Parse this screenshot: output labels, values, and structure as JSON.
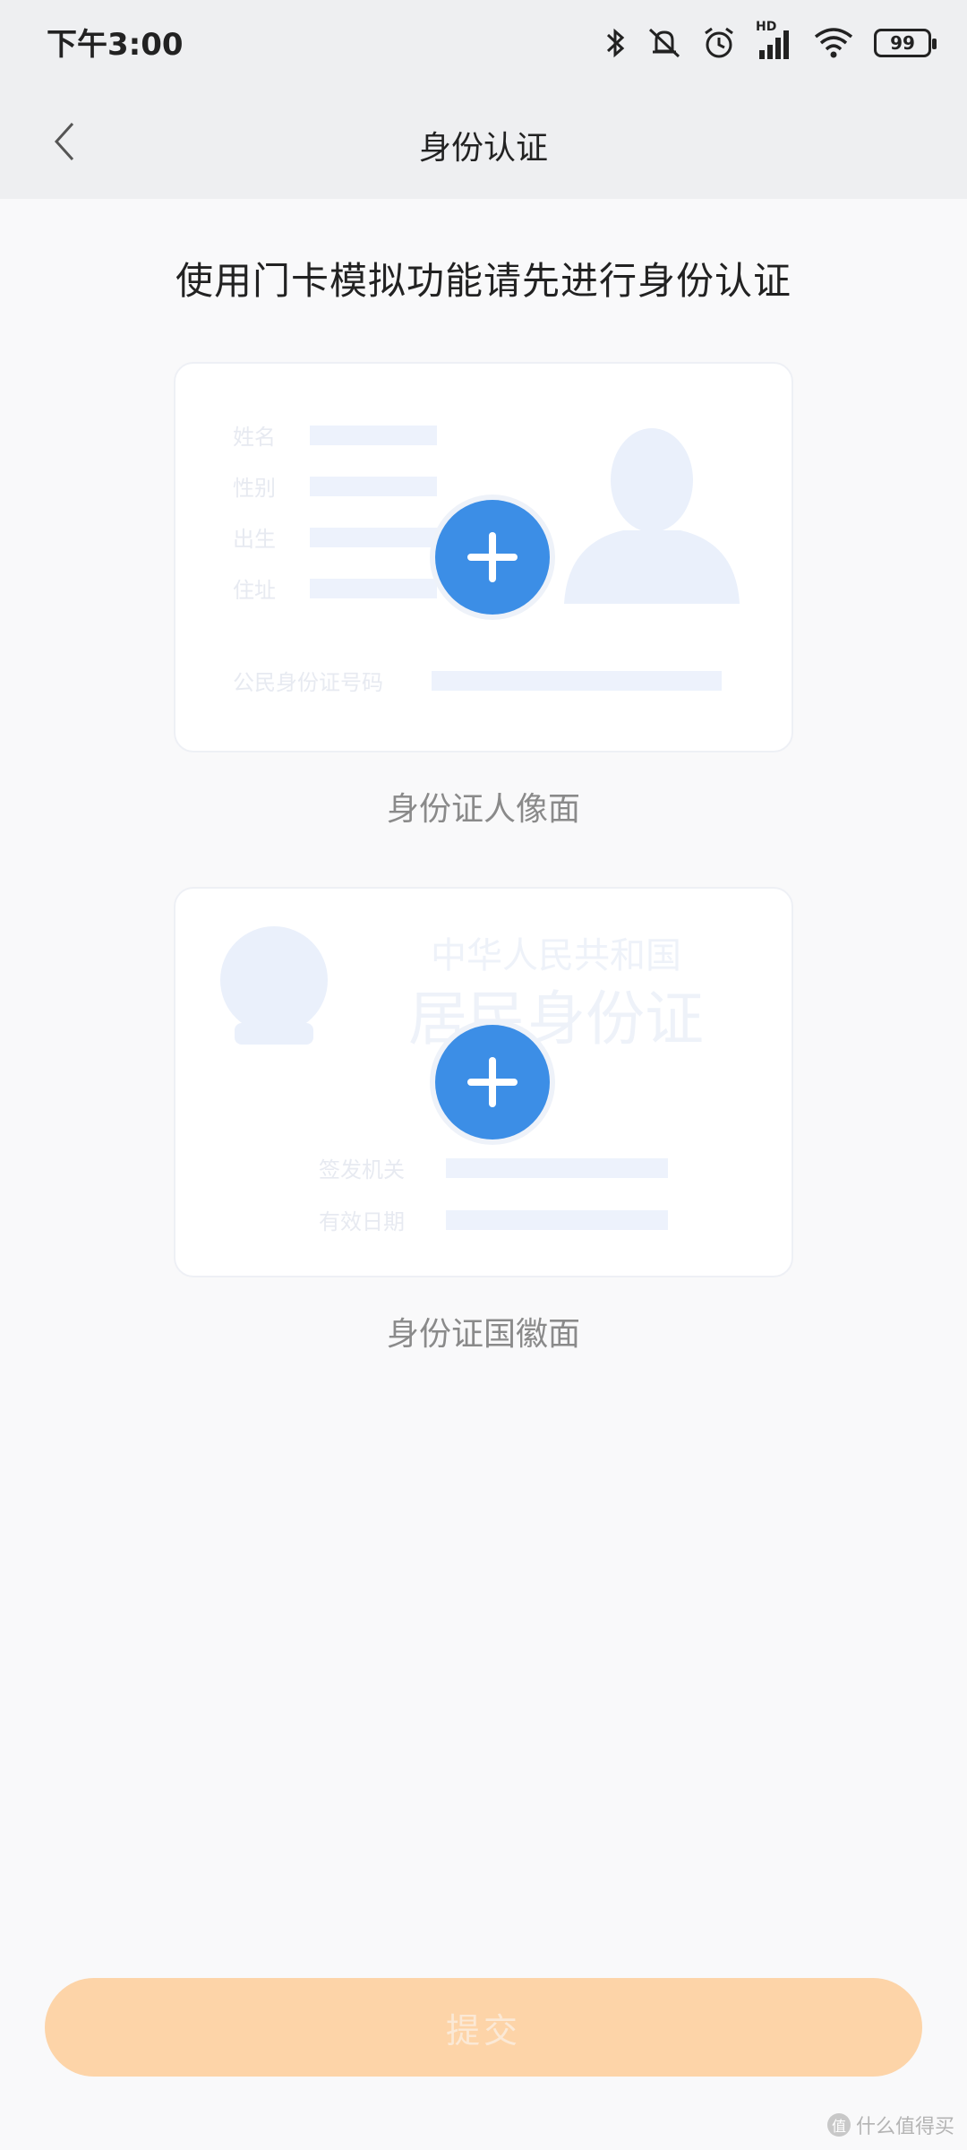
{
  "status_bar": {
    "time": "下午3:00",
    "network": "HD",
    "battery": "99"
  },
  "nav": {
    "title": "身份认证"
  },
  "intro": "使用门卡模拟功能请先进行身份认证",
  "card_front": {
    "label": "身份证人像面",
    "fields": [
      "姓名",
      "性别",
      "出生",
      "住址"
    ],
    "id_number_label": "公民身份证号码"
  },
  "card_back": {
    "label": "身份证国徽面",
    "country": "中华人民共和国",
    "card_name": "居民身份证",
    "fields": [
      "签发机关",
      "有效日期"
    ]
  },
  "submit_label": "提交",
  "watermark": "什么值得买"
}
